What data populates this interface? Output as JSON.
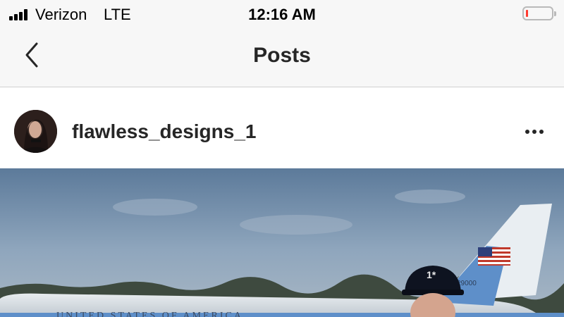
{
  "status_bar": {
    "carrier": "Verizon",
    "network": "LTE",
    "time": "12:16 AM",
    "signal_icon": "cellular-signal-icon",
    "battery_icon": "battery-low-icon",
    "battery_color": "#ff3b30"
  },
  "nav": {
    "back_icon": "chevron-left-icon",
    "title": "Posts"
  },
  "post": {
    "username": "flawless_designs_1",
    "more_icon": "ellipsis-icon",
    "photo": {
      "tail_number": "29000",
      "fuselage_text": "UNITED STATES OF AMERICA",
      "cap_text": "1*"
    }
  },
  "colors": {
    "bar_background": "#f7f7f7",
    "text_primary": "#262626",
    "divider": "#d0d0d0"
  }
}
